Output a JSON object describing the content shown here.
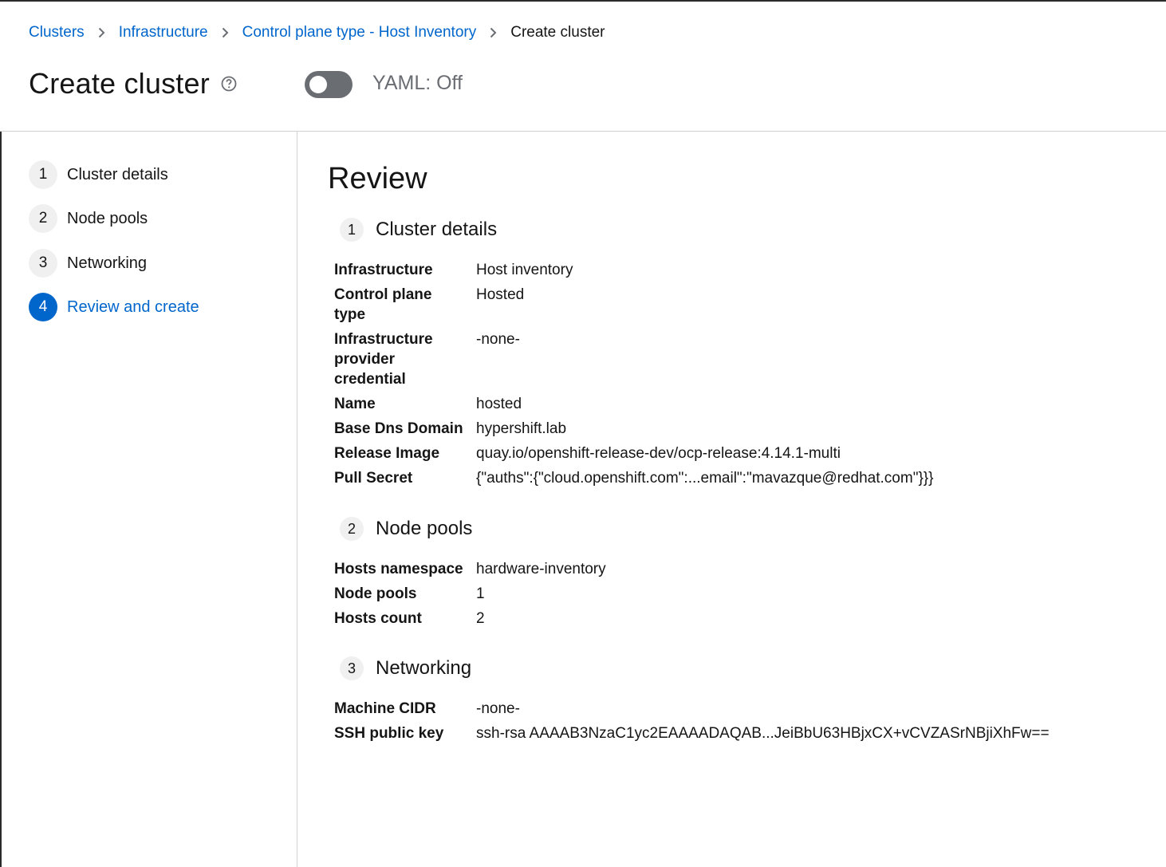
{
  "breadcrumb": {
    "items": [
      "Clusters",
      "Infrastructure",
      "Control plane type - Host Inventory"
    ],
    "current": "Create cluster"
  },
  "header": {
    "title": "Create cluster",
    "yaml_label": "YAML: Off",
    "yaml_on": false
  },
  "nav": {
    "steps": [
      {
        "num": "1",
        "label": "Cluster details"
      },
      {
        "num": "2",
        "label": "Node pools"
      },
      {
        "num": "3",
        "label": "Networking"
      },
      {
        "num": "4",
        "label": "Review and create",
        "active": true
      }
    ]
  },
  "review": {
    "title": "Review",
    "sections": [
      {
        "num": "1",
        "title": "Cluster details",
        "fields": [
          {
            "term": "Infrastructure",
            "value": "Host inventory"
          },
          {
            "term": "Control plane type",
            "value": "Hosted"
          },
          {
            "term": "Infrastructure provider credential",
            "value": "-none-"
          },
          {
            "term": "Name",
            "value": "hosted"
          },
          {
            "term": "Base Dns Domain",
            "value": "hypershift.lab"
          },
          {
            "term": "Release Image",
            "value": "quay.io/openshift-release-dev/ocp-release:4.14.1-multi"
          },
          {
            "term": "Pull Secret",
            "value": "{\"auths\":{\"cloud.openshift.com\":...email\":\"mavazque@redhat.com\"}}}"
          }
        ]
      },
      {
        "num": "2",
        "title": "Node pools",
        "fields": [
          {
            "term": "Hosts namespace",
            "value": "hardware-inventory"
          },
          {
            "term": "Node pools",
            "value": "1"
          },
          {
            "term": "Hosts count",
            "value": "2"
          }
        ]
      },
      {
        "num": "3",
        "title": "Networking",
        "fields": [
          {
            "term": "Machine CIDR",
            "value": "-none-"
          },
          {
            "term": "SSH public key",
            "value": "ssh-rsa AAAAB3NzaC1yc2EAAAADAQAB...JeiBbU63HBjxCX+vCVZASrNBjiXhFw=="
          }
        ]
      }
    ]
  },
  "colors": {
    "link": "#0066cc",
    "active_step": "#0066cc",
    "toggle_off": "#6a6e73"
  }
}
